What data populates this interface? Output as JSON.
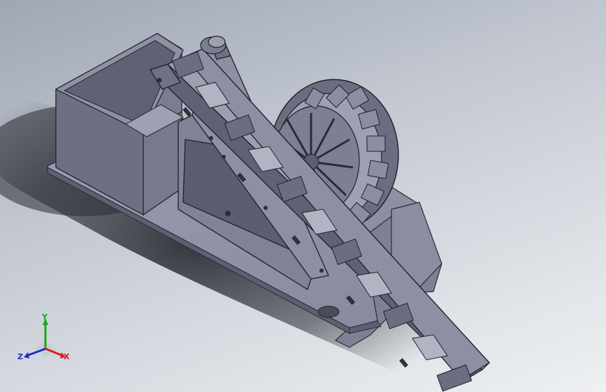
{
  "view": {
    "background_top": "#9fa7b5",
    "background_bottom": "#eef0f2",
    "part_color": "#8e92a3"
  },
  "triad": {
    "x_label": "X",
    "y_label": "Y",
    "z_label": "Z",
    "x_color": "#d42020",
    "y_color": "#18a818",
    "z_color": "#2030c8"
  }
}
